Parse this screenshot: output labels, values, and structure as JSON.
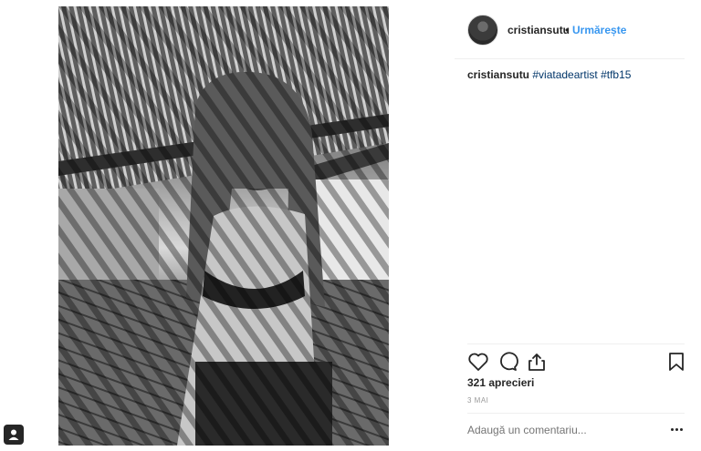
{
  "post": {
    "photo_icon": "person-photo",
    "photo_alt": ""
  },
  "header": {
    "username": "cristiansutu",
    "separator": "•",
    "follow_label": "Urmărește"
  },
  "caption": {
    "username": "cristiansutu",
    "hashtags": [
      "#viatadeartist",
      "#tfb15"
    ]
  },
  "actions": {
    "icons": [
      "heart-icon",
      "comment-icon",
      "share-icon",
      "bookmark-icon"
    ]
  },
  "likes_text": "321 aprecieri",
  "date_text": "3 MAI",
  "comment": {
    "placeholder": "Adaugă un comentariu...",
    "more_icon": "more-options-icon"
  },
  "corner": {
    "icon": "tagged-user-icon"
  },
  "colors": {
    "accent": "#3897f0",
    "hashtag": "#003569",
    "muted": "#999999",
    "text": "#262626"
  }
}
